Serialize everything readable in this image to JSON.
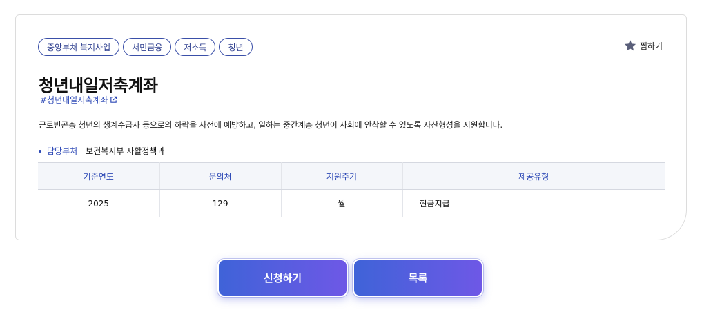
{
  "tags": [
    "중앙부처 복지사업",
    "서민금융",
    "저소득",
    "청년"
  ],
  "favorite_label": "찜하기",
  "title": "청년내일저축계좌",
  "hashtag": "#청년내일저축계좌",
  "description": "근로빈곤층 청년의 생계수급자 등으로의 하락을 사전에 예방하고, 일하는 중간계층 청년이 사회에 안착할 수 있도록 자산형성을 지원합니다.",
  "department": {
    "label": "담당부처",
    "value": "보건복지부 자활정책과"
  },
  "table": {
    "headers": [
      "기준연도",
      "문의처",
      "지원주기",
      "제공유형"
    ],
    "row": [
      "2025",
      "129",
      "월",
      "현금지급"
    ]
  },
  "buttons": {
    "apply": "신청하기",
    "list": "목록"
  },
  "colors": {
    "accent": "#2d49b6",
    "button_start": "#3f63d8",
    "button_end": "#6e58e6",
    "star": "#5a5f7a"
  },
  "icons": {
    "favorite": "star-icon",
    "external": "external-link-icon"
  }
}
